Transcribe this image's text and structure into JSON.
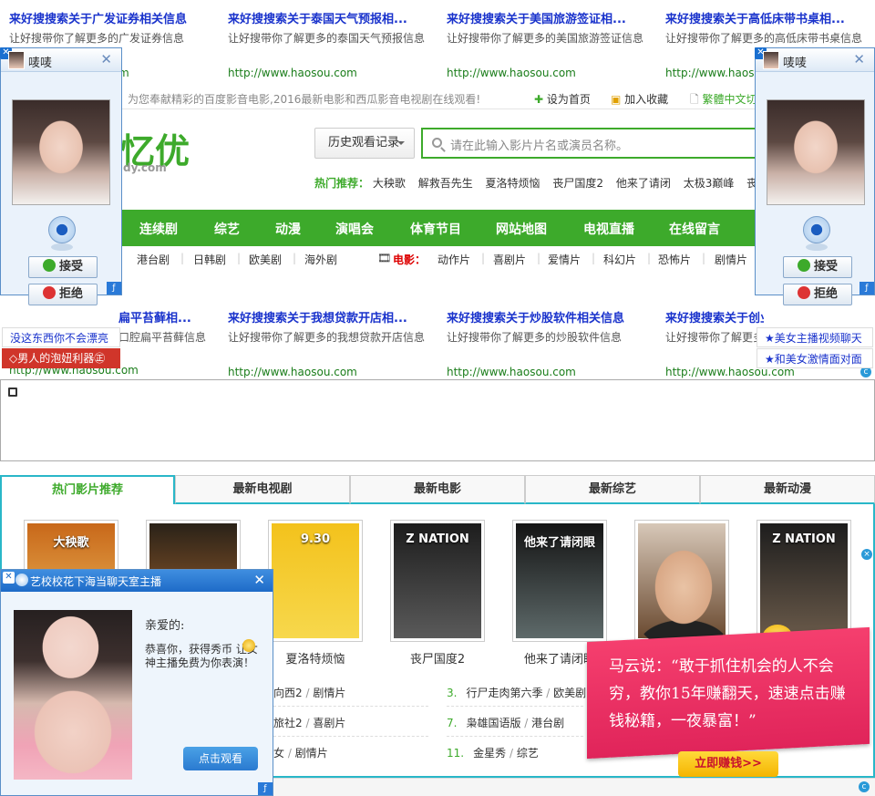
{
  "ads_top": [
    {
      "title": "来好搜搜索关于广发证券相关信息",
      "desc": "让好搜带你了解更多的广发证券信息",
      "url": ""
    },
    {
      "title": "来好搜搜索关于泰国天气预报相...",
      "desc": "让好搜带你了解更多的泰国天气预报信息",
      "url": "http://www.haosou.com"
    },
    {
      "title": "来好搜搜索关于美国旅游签证相...",
      "desc": "让好搜带你了解更多的美国旅游签证信息",
      "url": "http://www.haosou.com"
    },
    {
      "title": "来好搜搜索关于高低床带书桌相...",
      "desc": "让好搜带你了解更多的高低床带书桌信息",
      "url": "http://www.haosou.com"
    }
  ],
  "ads_mid": [
    {
      "title": "扁平苔藓相...",
      "desc": "口腔扁平苔藓信息",
      "url": "http://www.haosou.com"
    },
    {
      "title": "来好搜搜索关于我想贷款开店相...",
      "desc": "让好搜带你了解更多的我想贷款开店信息",
      "url": "http://www.haosou.com"
    },
    {
      "title": "来好搜搜索关于炒股软件相关信息",
      "desc": "让好搜带你了解更多的炒股软件信息",
      "url": "http://www.haosou.com"
    },
    {
      "title": "来好搜搜索关于创业项目相...",
      "desc": "让好搜带你了解更多的创业项目信息",
      "url": "http://www.haosou.com"
    }
  ],
  "topbar": {
    "slogan": "为您奉献精彩的百度影音电影,2016最新电影和西瓜影音电视剧在线观看!",
    "set_home": "设为首页",
    "add_fav": "加入收藏",
    "trad": "繁體中文切"
  },
  "logo": {
    "text": "忆优",
    "sub": "dy.com"
  },
  "search": {
    "history": "历史观看记录",
    "placeholder": "请在此输入影片片名或演员名称。"
  },
  "hot": {
    "label": "热门推荐：",
    "items": [
      "大秧歌",
      "解救吾先生",
      "夏洛特烦恼",
      "丧尸国度2",
      "他来了请闭",
      "太极3巅峰",
      "丧尸国"
    ]
  },
  "nav": [
    "连续剧",
    "综艺",
    "动漫",
    "演唱会",
    "体育节目",
    "网站地图",
    "电视直播",
    "在线留言"
  ],
  "subnav": {
    "tv": [
      "港台剧",
      "日韩剧",
      "欧美剧",
      "海外剧"
    ],
    "movie_label": "电影：",
    "movie": [
      "动作片",
      "喜剧片",
      "爱情片",
      "科幻片",
      "恐怖片",
      "剧情片"
    ]
  },
  "tabs": [
    "热门影片推荐",
    "最新电视剧",
    "最新电影",
    "最新综艺",
    "最新动漫"
  ],
  "posters": [
    {
      "title": "",
      "poster_text": "大秧歌",
      "colors": [
        "#c8681a",
        "#f0c060"
      ]
    },
    {
      "title": "",
      "poster_text": "",
      "colors": [
        "#2a2218",
        "#b06a30"
      ]
    },
    {
      "title": "夏洛特烦恼",
      "poster_text": "9.30",
      "colors": [
        "#f3c21c",
        "#f7d84c"
      ]
    },
    {
      "title": "丧尸国度2",
      "poster_text": "Z NATION",
      "colors": [
        "#1d1d1d",
        "#5a5a5a"
      ]
    },
    {
      "title": "他来了请闭眼",
      "poster_text": "他来了请闭眼",
      "colors": [
        "#141414",
        "#5e6a6a"
      ]
    },
    {
      "title": "",
      "poster_text": "",
      "colors": [
        "#d7c8b8",
        "#6a4a30"
      ]
    },
    {
      "title": "",
      "poster_text": "Z NATION",
      "colors": [
        "#1d1d1d",
        "#6a5a4a"
      ]
    }
  ],
  "list": [
    {
      "num": "",
      "text": "向西2",
      "cat": "剧情片"
    },
    {
      "num": "3.",
      "text": "行尸走肉第六季",
      "cat": "欧美剧"
    },
    {
      "num": "",
      "text": "旅社2",
      "cat": "喜剧片"
    },
    {
      "num": "7.",
      "text": "枭雄国语版",
      "cat": "港台剧"
    },
    {
      "num": "",
      "text": "女",
      "cat": "剧情片"
    },
    {
      "num": "11.",
      "text": "金星秀",
      "cat": "综艺"
    }
  ],
  "popup_left": {
    "name": "唛唛",
    "accept": "接受",
    "reject": "拒绝"
  },
  "popup_right": {
    "name": "唛唛",
    "accept": "接受",
    "reject": "拒绝"
  },
  "sidead_left": [
    "没这东西你不会漂亮",
    "◇男人的泡妞利器㊣"
  ],
  "sidead_right": [
    "★美女主播视频聊天",
    "★和美女激情面对面"
  ],
  "bchat": {
    "title": "艺校校花下海当聊天室主播",
    "dear": "亲爱的:",
    "msg": "恭喜你，获得秀币 让女神主播免费为你表演！",
    "watch": "点击观看"
  },
  "banner": {
    "text": "马云说：“敢于抓住机会的人不会穷，教你15年赚翻天，速速点击赚钱秘籍，一夜暴富！”",
    "cta": "立即赚钱>>"
  }
}
